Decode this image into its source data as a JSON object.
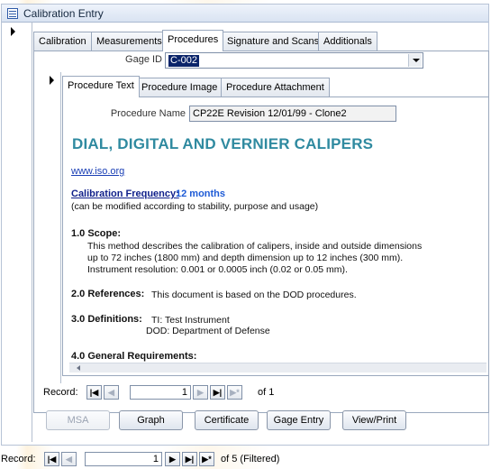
{
  "window": {
    "title": "Calibration Entry"
  },
  "main_tabs": [
    {
      "label": "Calibration"
    },
    {
      "label": "Measurements"
    },
    {
      "label": "Procedures"
    },
    {
      "label": "Signature and Scans"
    },
    {
      "label": "Additionals"
    }
  ],
  "gage": {
    "label": "Gage ID",
    "value": "C-002"
  },
  "sub_tabs": [
    {
      "label": "Procedure Text"
    },
    {
      "label": "Procedure Image"
    },
    {
      "label": "Procedure Attachment"
    }
  ],
  "procedure": {
    "name_label": "Procedure Name",
    "name_value": "CP22E Revision 12/01/99 - Clone2"
  },
  "document": {
    "title": "DIAL, DIGITAL AND VERNIER CALIPERS",
    "link": "www.iso.org",
    "freq_label": "Calibration Frequency:",
    "freq_value": "12 months",
    "freq_note": "(can be modified according to stability, purpose and usage)",
    "scope_heading": "1.0 Scope:",
    "scope_lines": [
      "This method describes the calibration of calipers, inside and outside dimensions",
      "up to 72 inches (1800 mm) and depth dimension up to 12 inches (300 mm).",
      "Instrument resolution:  0.001 or 0.0005 inch (0.02 or 0.05 mm)."
    ],
    "ref_heading": "2.0 References:",
    "ref_text": "This document is based on the DOD procedures.",
    "def_heading": "3.0 Definitions:",
    "def_lines": [
      "TI: Test Instrument",
      "DOD: Department of Defense"
    ],
    "general_heading": "4.0 General Requirements:"
  },
  "inner_nav": {
    "label": "Record:",
    "current": "1",
    "of_text": "of  1"
  },
  "buttons": {
    "msa": "MSA",
    "graph": "Graph",
    "certificate": "Certificate",
    "gage_entry": "Gage Entry",
    "view_print": "View/Print"
  },
  "outer_nav": {
    "label": "Record:",
    "current": "1",
    "of_text": "of  5 (Filtered)"
  }
}
